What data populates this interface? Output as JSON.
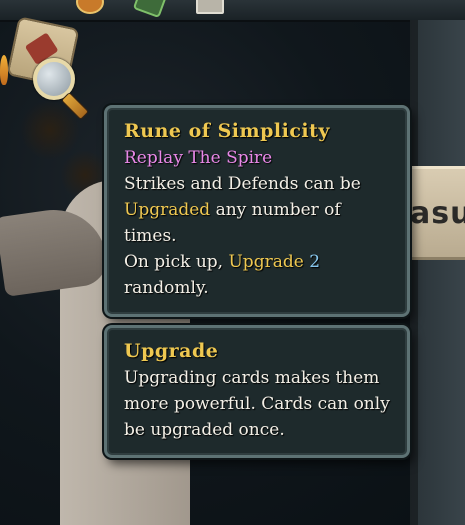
{
  "colors": {
    "title": "#efc851",
    "body": "#f3efe6",
    "source": "#e988e8",
    "keyword": "#efc851",
    "number": "#87c7ee",
    "tooltip_bg": "#1e2a2c",
    "tooltip_border": "#5d7274"
  },
  "scene": {
    "banner_text": "asu",
    "icons": [
      "relic-card-icon",
      "magnifier-icon",
      "flame-icon"
    ]
  },
  "relic_tooltip": {
    "title": "Rune of Simplicity",
    "source": "Replay The Spire",
    "line1": "Strikes and Defends can be",
    "keyword1": "Upgraded",
    "line2_rest": " any number of",
    "line3": "times.",
    "line4_start": "On pick up, ",
    "keyword2": "Upgrade",
    "space": " ",
    "number": "2",
    "line5": "randomly."
  },
  "keyword_tooltip": {
    "title": "Upgrade",
    "body": "Upgrading cards makes them more powerful. Cards can only be upgraded once."
  }
}
